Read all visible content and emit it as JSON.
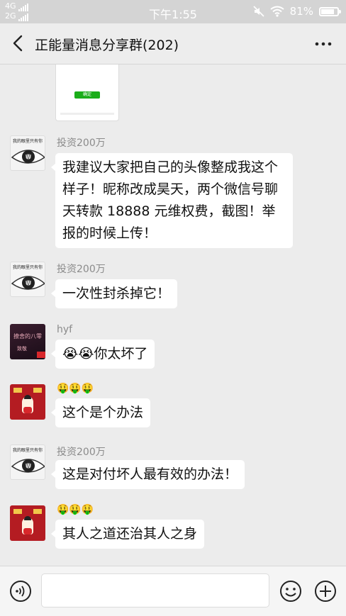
{
  "status_bar": {
    "network_top": "4G",
    "network_bottom": "2G",
    "time": "下午1:55",
    "battery": "81%",
    "battery_level": 0.81
  },
  "header": {
    "title": "正能量消息分享群(202)",
    "back_icon": "chevron-left-icon",
    "more_icon": "more-dots-icon"
  },
  "preview": {
    "button_text": "确定"
  },
  "messages": [
    {
      "sender": "投资200万",
      "avatar_text": "我的眼里只有你",
      "text": "我建议大家把自己的头像整成我这个样子！昵称改成昊天，两个微信号聊天转款 18888 元维权费，截图！举报的时候上传！"
    },
    {
      "sender": "投资200万",
      "avatar_text": "我的眼里只有你",
      "text": "一次性封杀掉它！"
    },
    {
      "sender": "hyf",
      "avatar_text_1": "撩舍的八零",
      "avatar_text_2": "致敬",
      "text": "😭😭你太坏了"
    },
    {
      "sender": "🤑🤑🤑",
      "text": "这个是个办法"
    },
    {
      "sender": "投资200万",
      "avatar_text": "我的眼里只有你",
      "text": "这是对付坏人最有效的办法！"
    },
    {
      "sender": "🤑🤑🤑",
      "text": "其人之道还治其人之身"
    }
  ],
  "input_bar": {
    "value": "",
    "placeholder": ""
  },
  "colors": {
    "chat_background": "#ececec",
    "bubble": "#ffffff",
    "sender_name": "#8b8b8b"
  }
}
